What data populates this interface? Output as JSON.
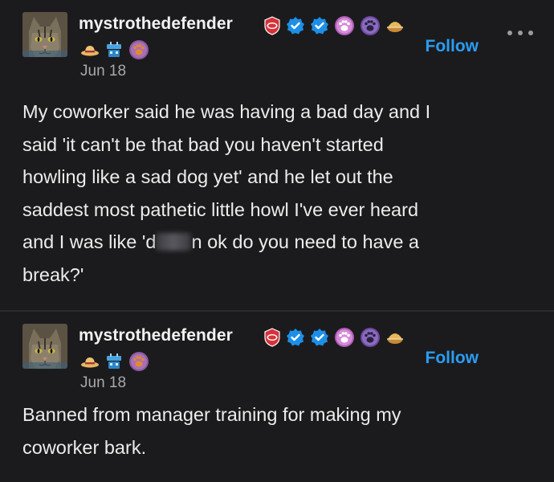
{
  "posts": [
    {
      "username": "mystrothedefender",
      "date": "Jun 18",
      "follow_label": "Follow",
      "body_lines": [
        "My coworker said he was having a bad day and I",
        "said 'it can't be that bad you haven't started",
        "howling like a sad dog yet' and he let out the",
        "saddest most pathetic little howl I've ever heard"
      ],
      "body_line5_a": "and I was like 'd",
      "body_line5_b": "n ok do you need to have a",
      "body_line6": "break?'"
    },
    {
      "username": "mystrothedefender",
      "date": "Jun 18",
      "follow_label": "Follow",
      "body_lines": [
        "Banned from manager training for making my",
        "coworker bark."
      ]
    }
  ],
  "icons": {
    "avatar": "cat-avatar",
    "badges": [
      "red-shield-badge",
      "verified-badge",
      "verified-badge",
      "pink-paw-badge",
      "purple-paw-badge",
      "bread-bowl-badge",
      "straw-hat-badge",
      "blue-robot-badge",
      "orange-paw-badge"
    ],
    "more": "more-options-icon"
  },
  "colors": {
    "background": "#1b1b1d",
    "text": "#ececec",
    "muted": "#a8a8ad",
    "accent": "#2a9df4"
  }
}
